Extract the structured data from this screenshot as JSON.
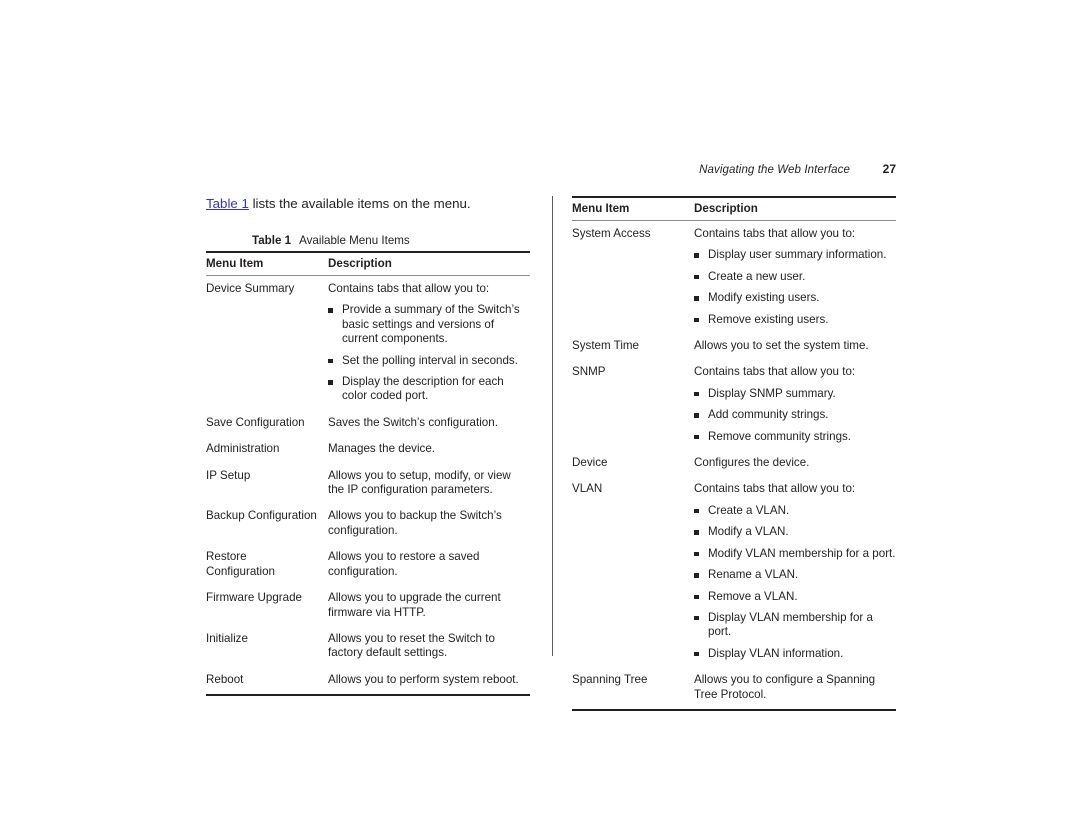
{
  "header": {
    "title": "Navigating the Web Interface",
    "page_number": "27"
  },
  "intro": {
    "link_text": "Table 1",
    "rest_text": " lists the available items on the menu."
  },
  "table": {
    "caption_number": "Table 1",
    "caption_title": "Available Menu Items",
    "columns": {
      "item": "Menu Item",
      "description": "Description"
    },
    "rows_left": [
      {
        "item": "Device Summary",
        "indent": 0,
        "lead_in": "Contains tabs that allow you to:",
        "bullets": [
          "Provide a summary of the Switch’s basic settings and versions of current components.",
          "Set the polling interval in seconds.",
          "Display the description for each color coded port."
        ]
      },
      {
        "item": "Save Configuration",
        "indent": 0,
        "lead_in": "Saves the Switch’s configuration.",
        "bullets": []
      },
      {
        "item": "Administration",
        "indent": 0,
        "lead_in": "Manages the device.",
        "bullets": []
      },
      {
        "item": "IP Setup",
        "indent": 1,
        "lead_in": "Allows you to setup, modify, or view the IP configuration parameters.",
        "bullets": []
      },
      {
        "item": "Backup Configuration",
        "indent": 1,
        "lead_in": "Allows you to backup the Switch’s configuration.",
        "bullets": []
      },
      {
        "item": "Restore Configuration",
        "indent": 1,
        "lead_in": "Allows you to restore a saved configuration.",
        "bullets": []
      },
      {
        "item": "Firmware Upgrade",
        "indent": 1,
        "lead_in": "Allows you to upgrade the current firmware via HTTP.",
        "bullets": []
      },
      {
        "item": "Initialize",
        "indent": 1,
        "lead_in": "Allows you to reset the Switch to factory default settings.",
        "bullets": []
      },
      {
        "item": "Reboot",
        "indent": 1,
        "lead_in": "Allows you to perform system reboot.",
        "bullets": []
      }
    ],
    "rows_right": [
      {
        "item": "System Access",
        "indent": 1,
        "lead_in": "Contains tabs that allow you to:",
        "bullets": [
          "Display user summary information.",
          "Create a new user.",
          "Modify existing users.",
          "Remove existing users."
        ]
      },
      {
        "item": "System Time",
        "indent": 1,
        "lead_in": "Allows you to set the system time.",
        "bullets": []
      },
      {
        "item": "SNMP",
        "indent": 1,
        "lead_in": "Contains tabs that allow you to:",
        "bullets": [
          "Display SNMP summary.",
          "Add community strings.",
          "Remove community strings."
        ]
      },
      {
        "item": "Device",
        "indent": 0,
        "lead_in": "Configures the device.",
        "bullets": []
      },
      {
        "item": "VLAN",
        "indent": 1,
        "lead_in": "Contains tabs that allow you to:",
        "bullets": [
          "Create a VLAN.",
          "Modify a VLAN.",
          "Modify VLAN membership for a port.",
          "Rename a VLAN.",
          "Remove a VLAN.",
          "Display VLAN membership for a port.",
          "Display VLAN information."
        ]
      },
      {
        "item": "Spanning Tree",
        "indent": 1,
        "lead_in": "Allows you to configure a Spanning Tree Protocol.",
        "bullets": []
      }
    ]
  },
  "colors": {
    "text": "#231f20",
    "link": "#3333cc",
    "rule": "#231f20",
    "divider": "#5a5a5f"
  }
}
